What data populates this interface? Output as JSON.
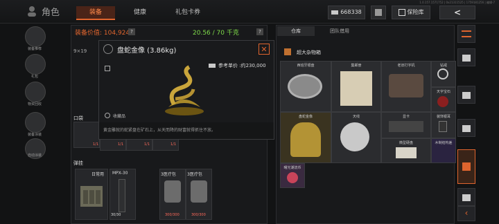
{
  "header": {
    "version_text": "1.0.157.1571752 | 0x21311525 | 1759181256 | 编辑-7",
    "title": "角色",
    "tabs": [
      {
        "label": "装备",
        "active": true
      },
      {
        "label": "健康",
        "active": false
      },
      {
        "label": "礼包卡券",
        "active": false
      }
    ],
    "currency": "668338",
    "safe_label": "保险库",
    "back_label": "<"
  },
  "left_menu": [
    {
      "label": "装备推荐"
    },
    {
      "label": "礼包"
    },
    {
      "label": "物资回收"
    },
    {
      "label": "装备涂装"
    },
    {
      "label": "自动涂装"
    }
  ],
  "equipment": {
    "value_label": "装备价值:",
    "value": "104,924",
    "weight": "20.56 / 70 千克",
    "slot_label": "9×19",
    "pocket_label": "口袋",
    "magazine_label": "弹挂",
    "count_labels": [
      "1/1",
      "1/1",
      "1/1",
      "1/1",
      "1/1"
    ],
    "bottom_items": [
      {
        "name": "日常用",
        "count": ""
      },
      {
        "name": "MPX-30",
        "count": "30/30"
      },
      {
        "name": "3医疗包",
        "count": "300/300"
      },
      {
        "name": "3医疗包",
        "count": "300/300"
      }
    ]
  },
  "tooltip": {
    "title": "盘蛇金像 (3.86kg)",
    "price_label": "参考单价 :约230,000",
    "tag": "收藏品",
    "description": "黄金雕就的蛇紧盘在矿石上，从天而降的财富就得抓住不放。"
  },
  "storage": {
    "tabs": [
      {
        "label": "仓库",
        "active": true
      },
      {
        "label": "团队借用",
        "active": false
      }
    ],
    "section_title": "超大杂物箱",
    "items": [
      {
        "name": "西班牙银盘"
      },
      {
        "name": "集邮册"
      },
      {
        "name": "老旧打字机"
      },
      {
        "name": "钻戒"
      },
      {
        "name": "天字宝石"
      },
      {
        "name": "盘蛇金像"
      },
      {
        "name": "天线"
      },
      {
        "name": "显卡"
      },
      {
        "name": "装饰银耳"
      },
      {
        "name": "微型硬盘"
      },
      {
        "name": "木制结构差"
      },
      {
        "name": "曙光潮流币"
      }
    ]
  },
  "colors": {
    "accent": "#e0652e",
    "bg": "#121314",
    "value_red": "#ff5a4a",
    "weight_green": "#7fdc4a"
  }
}
